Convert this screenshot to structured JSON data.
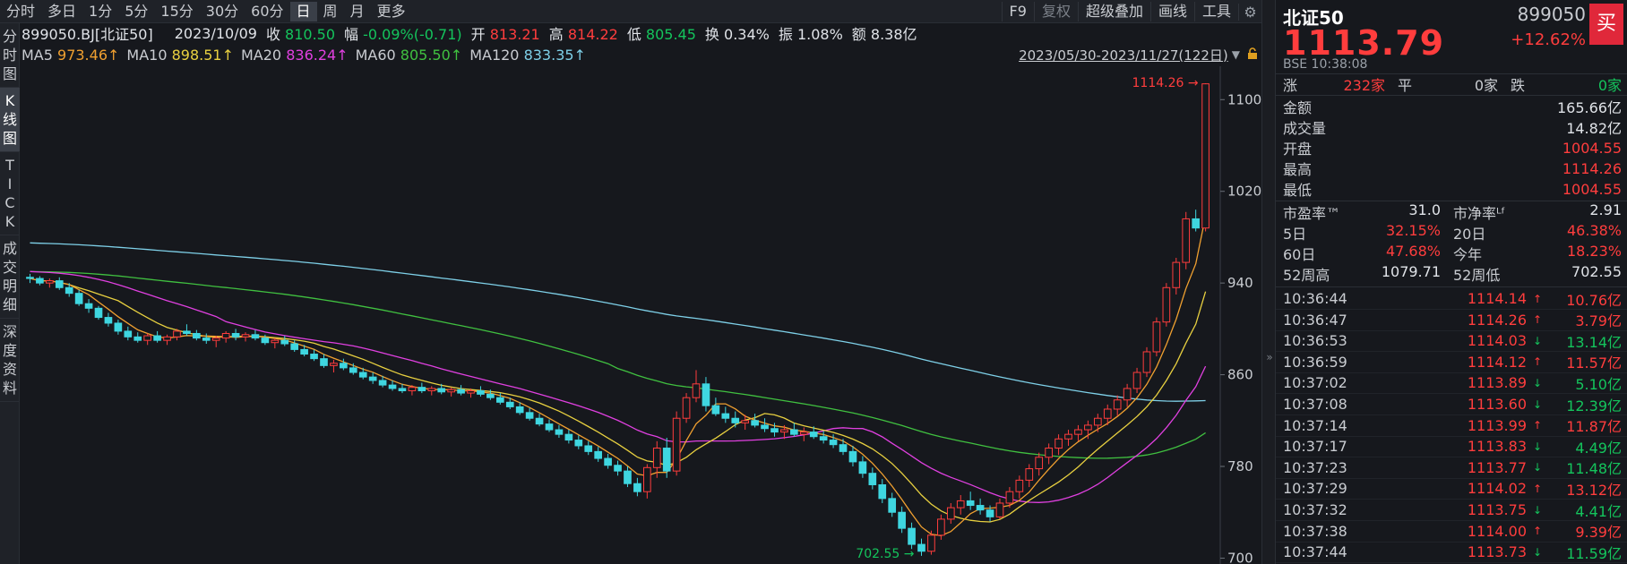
{
  "toolbar": {
    "periods": [
      "分时",
      "多日",
      "1分",
      "5分",
      "15分",
      "30分",
      "60分",
      "日",
      "周",
      "月",
      "更多"
    ],
    "active_period": "日",
    "tools": [
      "F9",
      "复权",
      "超级叠加",
      "画线",
      "工具"
    ],
    "settings_icon": "gear-icon"
  },
  "leftnav": [
    "分时图",
    "K线图",
    "TICK",
    "成交明细",
    "深度资料"
  ],
  "info": {
    "symbol": "899050.BJ[北证50]",
    "date": "2023/10/09",
    "close_label": "收",
    "close": "810.50",
    "range_label": "幅",
    "range": "-0.09%(-0.71)",
    "open_label": "开",
    "open": "813.21",
    "high_label": "高",
    "high": "814.22",
    "low_label": "低",
    "low": "805.45",
    "turnover_label": "换",
    "turnover": "0.34%",
    "amplitude_label": "振",
    "amplitude": "1.08%",
    "amount_label": "额",
    "amount": "8.38亿"
  },
  "ma": [
    {
      "label": "MA5",
      "value": "973.46↑",
      "color": "#f0a030"
    },
    {
      "label": "MA10",
      "value": "898.51↑",
      "color": "#e8d040"
    },
    {
      "label": "MA20",
      "value": "836.24↑",
      "color": "#e040e0"
    },
    {
      "label": "MA60",
      "value": "805.50↑",
      "color": "#40c040"
    },
    {
      "label": "MA120",
      "value": "833.35↑",
      "color": "#7ed0e8"
    }
  ],
  "date_range": "2023/05/30-2023/11/27(122日)",
  "chart_data": {
    "type": "candlestick",
    "y_ticks": [
      700,
      780,
      860,
      940,
      1020,
      1100
    ],
    "ylim": [
      698,
      1126
    ],
    "n_days": 122,
    "max_label": "1114.26",
    "min_label": "702.55",
    "candles": [
      [
        945,
        948,
        940,
        944
      ],
      [
        944,
        946,
        938,
        940
      ],
      [
        940,
        944,
        936,
        942
      ],
      [
        942,
        945,
        934,
        936
      ],
      [
        936,
        940,
        928,
        931
      ],
      [
        931,
        934,
        920,
        922
      ],
      [
        922,
        926,
        914,
        918
      ],
      [
        918,
        920,
        908,
        910
      ],
      [
        910,
        914,
        902,
        905
      ],
      [
        905,
        908,
        895,
        898
      ],
      [
        898,
        902,
        890,
        893
      ],
      [
        893,
        897,
        888,
        890
      ],
      [
        890,
        896,
        886,
        894
      ],
      [
        894,
        898,
        888,
        890
      ],
      [
        890,
        895,
        886,
        893
      ],
      [
        893,
        900,
        890,
        898
      ],
      [
        898,
        904,
        894,
        896
      ],
      [
        896,
        899,
        890,
        892
      ],
      [
        892,
        896,
        887,
        890
      ],
      [
        890,
        894,
        884,
        892
      ],
      [
        892,
        898,
        888,
        896
      ],
      [
        896,
        900,
        890,
        893
      ],
      [
        893,
        897,
        889,
        895
      ],
      [
        895,
        899,
        890,
        892
      ],
      [
        892,
        895,
        886,
        888
      ],
      [
        888,
        892,
        883,
        890
      ],
      [
        890,
        894,
        885,
        887
      ],
      [
        887,
        890,
        880,
        882
      ],
      [
        882,
        886,
        876,
        878
      ],
      [
        878,
        882,
        872,
        874
      ],
      [
        874,
        878,
        866,
        868
      ],
      [
        868,
        873,
        862,
        870
      ],
      [
        870,
        874,
        864,
        866
      ],
      [
        866,
        870,
        860,
        862
      ],
      [
        862,
        866,
        856,
        858
      ],
      [
        858,
        862,
        852,
        855
      ],
      [
        855,
        859,
        849,
        851
      ],
      [
        851,
        855,
        846,
        848
      ],
      [
        848,
        852,
        844,
        846
      ],
      [
        846,
        851,
        842,
        849
      ],
      [
        849,
        853,
        844,
        846
      ],
      [
        846,
        850,
        842,
        848
      ],
      [
        848,
        852,
        843,
        845
      ],
      [
        845,
        849,
        841,
        847
      ],
      [
        847,
        851,
        842,
        844
      ],
      [
        844,
        848,
        840,
        846
      ],
      [
        846,
        850,
        841,
        843
      ],
      [
        843,
        847,
        838,
        840
      ],
      [
        840,
        844,
        834,
        836
      ],
      [
        836,
        840,
        830,
        832
      ],
      [
        832,
        836,
        825,
        827
      ],
      [
        827,
        831,
        820,
        822
      ],
      [
        822,
        826,
        815,
        817
      ],
      [
        817,
        821,
        810,
        812
      ],
      [
        812,
        816,
        805,
        808
      ],
      [
        808,
        812,
        800,
        803
      ],
      [
        803,
        807,
        795,
        798
      ],
      [
        798,
        802,
        790,
        793
      ],
      [
        793,
        797,
        784,
        787
      ],
      [
        787,
        791,
        778,
        781
      ],
      [
        781,
        785,
        772,
        776
      ],
      [
        776,
        780,
        762,
        765
      ],
      [
        765,
        770,
        754,
        758
      ],
      [
        758,
        782,
        752,
        779
      ],
      [
        779,
        802,
        770,
        796
      ],
      [
        796,
        805,
        770,
        776
      ],
      [
        776,
        828,
        772,
        822
      ],
      [
        822,
        844,
        818,
        840
      ],
      [
        840,
        864,
        836,
        852
      ],
      [
        852,
        858,
        828,
        833
      ],
      [
        833,
        840,
        824,
        826
      ],
      [
        826,
        832,
        818,
        822
      ],
      [
        822,
        828,
        814,
        818
      ],
      [
        818,
        825,
        812,
        820
      ],
      [
        820,
        826,
        814,
        816
      ],
      [
        816,
        822,
        810,
        813
      ],
      [
        813,
        818,
        806,
        810
      ],
      [
        810,
        816,
        804,
        812
      ],
      [
        812,
        818,
        806,
        808
      ],
      [
        808,
        814,
        802,
        810
      ],
      [
        810,
        815,
        804,
        806
      ],
      [
        806,
        811,
        800,
        803
      ],
      [
        803,
        808,
        796,
        799
      ],
      [
        799,
        804,
        790,
        793
      ],
      [
        793,
        798,
        780,
        784
      ],
      [
        784,
        789,
        770,
        774
      ],
      [
        774,
        779,
        760,
        764
      ],
      [
        764,
        769,
        748,
        752
      ],
      [
        752,
        757,
        736,
        740
      ],
      [
        740,
        745,
        722,
        726
      ],
      [
        726,
        731,
        708,
        712
      ],
      [
        712,
        717,
        702,
        706
      ],
      [
        706,
        724,
        703,
        720
      ],
      [
        720,
        738,
        716,
        734
      ],
      [
        734,
        748,
        730,
        744
      ],
      [
        744,
        755,
        738,
        750
      ],
      [
        750,
        758,
        742,
        746
      ],
      [
        746,
        752,
        738,
        742
      ],
      [
        742,
        746,
        732,
        736
      ],
      [
        736,
        752,
        734,
        748
      ],
      [
        748,
        762,
        744,
        758
      ],
      [
        758,
        772,
        752,
        768
      ],
      [
        768,
        782,
        762,
        778
      ],
      [
        778,
        792,
        772,
        788
      ],
      [
        788,
        800,
        782,
        796
      ],
      [
        796,
        808,
        790,
        804
      ],
      [
        804,
        812,
        798,
        808
      ],
      [
        808,
        816,
        802,
        812
      ],
      [
        812,
        820,
        804,
        816
      ],
      [
        816,
        826,
        810,
        822
      ],
      [
        822,
        834,
        816,
        830
      ],
      [
        830,
        842,
        824,
        838
      ],
      [
        838,
        852,
        832,
        848
      ],
      [
        848,
        866,
        844,
        862
      ],
      [
        862,
        884,
        858,
        880
      ],
      [
        880,
        910,
        876,
        906
      ],
      [
        906,
        940,
        902,
        936
      ],
      [
        936,
        962,
        930,
        958
      ],
      [
        958,
        1002,
        952,
        996
      ],
      [
        996,
        1004,
        985,
        988
      ],
      [
        988,
        1114.26,
        985,
        1113.79
      ]
    ]
  },
  "panel": {
    "name": "北证50",
    "code": "899050",
    "price": "1113.79",
    "change_pct": "+12.62%",
    "buy_label": "买",
    "exchange_time": "BSE  10:38:08",
    "breadth": {
      "up_label": "涨",
      "up": "232家",
      "flat_label": "平",
      "flat": "0家",
      "down_label": "跌",
      "down": "0家"
    },
    "stats": [
      {
        "k": "金额",
        "v": "165.66亿",
        "c": "#e0e3e8"
      },
      {
        "k": "成交量",
        "v": "14.82亿",
        "c": "#e0e3e8"
      },
      {
        "k": "开盘",
        "v": "1004.55",
        "c": "#ff3d3d"
      },
      {
        "k": "最高",
        "v": "1114.26",
        "c": "#ff3d3d"
      },
      {
        "k": "最低",
        "v": "1004.55",
        "c": "#ff3d3d"
      }
    ],
    "ratios": [
      {
        "k1": "市盈率™",
        "v1": "31.0",
        "c1": "#e0e3e8",
        "k2": "市净率ᴸᶠ",
        "v2": "2.91",
        "c2": "#e0e3e8"
      },
      {
        "k1": "5日",
        "v1": "32.15%",
        "c1": "#ff3d3d",
        "k2": "20日",
        "v2": "46.38%",
        "c2": "#ff3d3d"
      },
      {
        "k1": "60日",
        "v1": "47.68%",
        "c1": "#ff3d3d",
        "k2": "今年",
        "v2": "18.23%",
        "c2": "#ff3d3d"
      },
      {
        "k1": "52周高",
        "v1": "1079.71",
        "c1": "#e0e3e8",
        "k2": "52周低",
        "v2": "702.55",
        "c2": "#e0e3e8"
      }
    ],
    "ticks": [
      {
        "t": "10:36:44",
        "p": "1114.14",
        "dir": "up",
        "v": "10.76亿"
      },
      {
        "t": "10:36:47",
        "p": "1114.26",
        "dir": "up",
        "v": "3.79亿"
      },
      {
        "t": "10:36:53",
        "p": "1114.03",
        "dir": "down",
        "v": "13.14亿"
      },
      {
        "t": "10:36:59",
        "p": "1114.12",
        "dir": "up",
        "v": "11.57亿"
      },
      {
        "t": "10:37:02",
        "p": "1113.89",
        "dir": "down",
        "v": "5.10亿"
      },
      {
        "t": "10:37:08",
        "p": "1113.60",
        "dir": "down",
        "v": "12.39亿"
      },
      {
        "t": "10:37:14",
        "p": "1113.99",
        "dir": "up",
        "v": "11.87亿"
      },
      {
        "t": "10:37:17",
        "p": "1113.83",
        "dir": "down",
        "v": "4.49亿"
      },
      {
        "t": "10:37:23",
        "p": "1113.77",
        "dir": "down",
        "v": "11.48亿"
      },
      {
        "t": "10:37:29",
        "p": "1114.02",
        "dir": "up",
        "v": "13.12亿"
      },
      {
        "t": "10:37:32",
        "p": "1113.75",
        "dir": "down",
        "v": "4.41亿"
      },
      {
        "t": "10:37:38",
        "p": "1114.00",
        "dir": "up",
        "v": "9.39亿"
      },
      {
        "t": "10:37:44",
        "p": "1113.73",
        "dir": "down",
        "v": "11.59亿"
      }
    ]
  }
}
